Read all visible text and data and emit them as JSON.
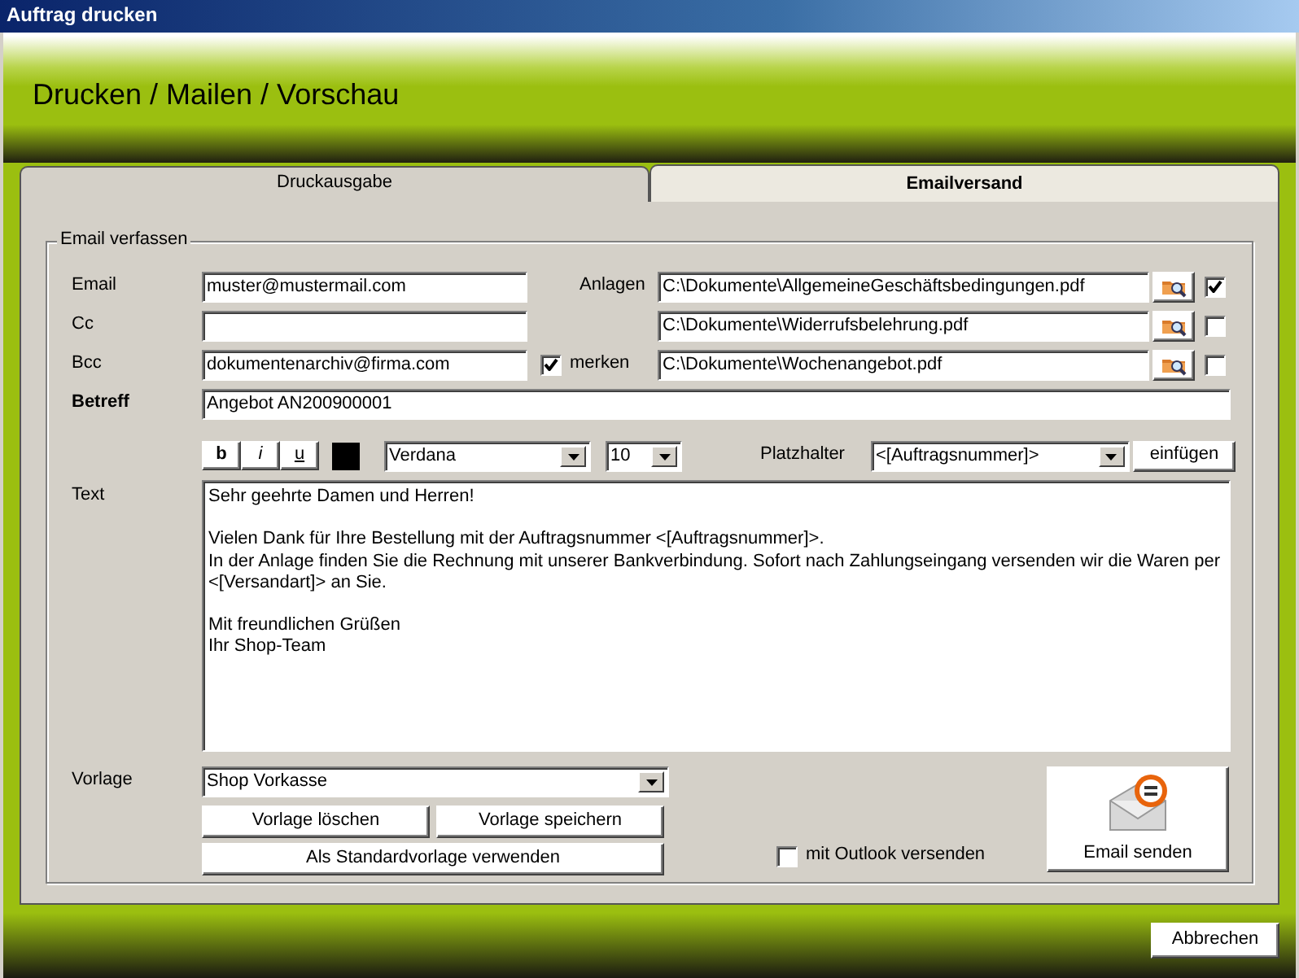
{
  "window": {
    "title": "Auftrag drucken"
  },
  "header": {
    "title": "Drucken / Mailen / Vorschau"
  },
  "tabs": [
    {
      "label": "Druckausgabe",
      "selected": false
    },
    {
      "label": "Emailversand",
      "selected": true
    }
  ],
  "group": {
    "legend": "Email verfassen"
  },
  "fields": [
    {
      "label": "Email",
      "value": "muster@mustermail.com"
    },
    {
      "label": "Cc"
    },
    {
      "label": "Bcc",
      "value": "dokumentenarchiv@firma.com"
    }
  ],
  "remember": {
    "label": "merken",
    "checked": true
  },
  "attachments": {
    "label": "Anlagen",
    "items": [
      {
        "path": "C:\\Dokumente\\AllgemeineGeschäftsbedingungen.pdf",
        "checked": true
      },
      {
        "path": "C:\\Dokumente\\Widerrufsbelehrung.pdf",
        "checked": false
      },
      {
        "path": "C:\\Dokumente\\Wochenangebot.pdf",
        "checked": false
      }
    ]
  },
  "subject": {
    "label": "Betreff",
    "value": "Angebot AN200900001"
  },
  "toolbar": {
    "format_buttons": [
      {
        "label": "b",
        "kind": "bold"
      },
      {
        "label": "i",
        "kind": "italic"
      },
      {
        "label": "u",
        "kind": "underline"
      }
    ],
    "font": "Verdana",
    "size": "10",
    "placeholder_label": "Platzhalter",
    "placeholder_value": "<[Auftragsnummer]>",
    "insert_button": "einfügen"
  },
  "text": {
    "label": "Text",
    "body": "Sehr geehrte Damen und Herren!\n\nVielen Dank für Ihre Bestellung mit der Auftragsnummer <[Auftragsnummer]>.\nIn der Anlage finden Sie die Rechnung mit unserer Bankverbindung. Sofort nach Zahlungseingang versenden wir die Waren per\n<[Versandart]> an Sie.\n\nMit freundlichen Grüßen\nIhr Shop-Team"
  },
  "template": {
    "label": "Vorlage",
    "value": "Shop Vorkasse",
    "buttons": [
      "Vorlage löschen",
      "Vorlage speichern",
      "Als Standardvorlage verwenden"
    ]
  },
  "outlook": {
    "label": "mit Outlook versenden",
    "checked": false
  },
  "send_button": "Email senden",
  "cancel_button": "Abbrechen"
}
